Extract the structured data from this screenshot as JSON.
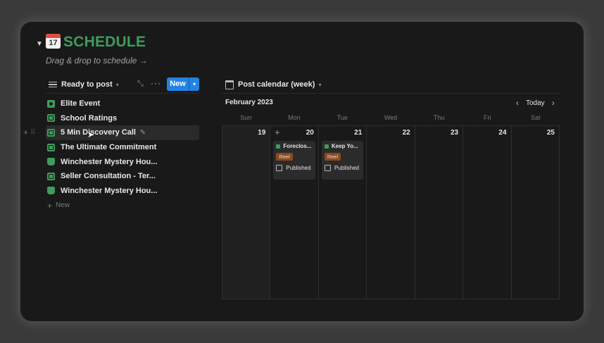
{
  "header": {
    "title": "SCHEDULE",
    "calendar_emoji_number": "17",
    "subtitle": "Drag & drop to schedule →"
  },
  "left_panel": {
    "view_label": "Ready to post",
    "new_button": "New",
    "items": [
      {
        "label": "Elite Event",
        "icon": "camera-icon"
      },
      {
        "label": "School Ratings",
        "icon": "film-icon"
      },
      {
        "label": "5 Min Discovery Call",
        "icon": "film-icon"
      },
      {
        "label": "The Ultimate Commitment",
        "icon": "film-icon"
      },
      {
        "label": "Winchester Mystery Hou...",
        "icon": "cup-icon"
      },
      {
        "label": "Seller Consultation - Ter...",
        "icon": "film-icon"
      },
      {
        "label": "Winchester Mystery Hou...",
        "icon": "cup-icon"
      }
    ],
    "new_row": "New"
  },
  "calendar": {
    "view_label": "Post calendar (week)",
    "month": "February 2023",
    "today_label": "Today",
    "weekdays": [
      "Sun",
      "Mon",
      "Tue",
      "Wed",
      "Thu",
      "Fri",
      "Sat"
    ],
    "days": [
      "19",
      "20",
      "21",
      "22",
      "23",
      "24",
      "25"
    ],
    "cards": [
      {
        "title": "Foreclos...",
        "tag": "Reel",
        "checkbox_label": "Published"
      },
      {
        "title": "Keep Yo...",
        "tag": "Reel",
        "checkbox_label": "Published"
      }
    ]
  },
  "colors": {
    "title_green": "#3f9c5c",
    "accent_blue": "#2383e2",
    "tag_orange": "#8a4a21"
  }
}
